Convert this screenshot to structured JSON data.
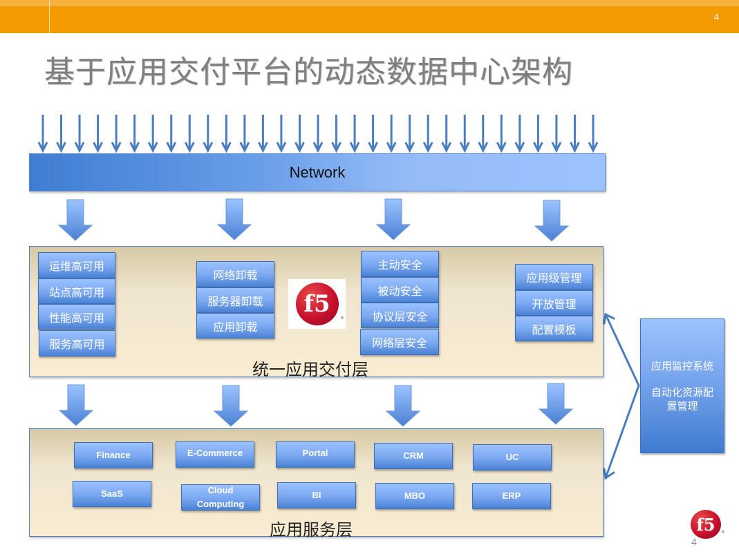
{
  "slide": {
    "title": "基于应用交付平台的动态数据中心架构",
    "page_number_top": "4",
    "page_number_bottom": "4",
    "accent_color": "#f39a00"
  },
  "network": {
    "label": "Network",
    "incoming_arrow_count": 31
  },
  "delivery_layer": {
    "label": "统一应用交付层",
    "groups": [
      {
        "name": "availability",
        "items": [
          "运维高可用",
          "站点高可用",
          "性能高可用",
          "服务高可用"
        ]
      },
      {
        "name": "offload",
        "items": [
          "网络卸载",
          "服务器卸载",
          "应用卸载"
        ]
      },
      {
        "name": "security",
        "items": [
          "主动安全",
          "被动安全",
          "协议层安全",
          "网络层安全"
        ]
      },
      {
        "name": "management",
        "items": [
          "应用级管理",
          "开放管理",
          "配置模板"
        ]
      }
    ],
    "logo": {
      "text": "f5",
      "mark": "®"
    }
  },
  "service_layer": {
    "label": "应用服务层",
    "apps": [
      "Finance",
      "E-Commerce",
      "Portal",
      "CRM",
      "UC",
      "SaaS",
      "Cloud Computing",
      "BI",
      "MBO",
      "ERP"
    ]
  },
  "side_panel": {
    "line1": "应用监控系统",
    "line2": "自动化资源配置管理"
  },
  "footer_logo": {
    "text": "f5",
    "mark": "®"
  }
}
